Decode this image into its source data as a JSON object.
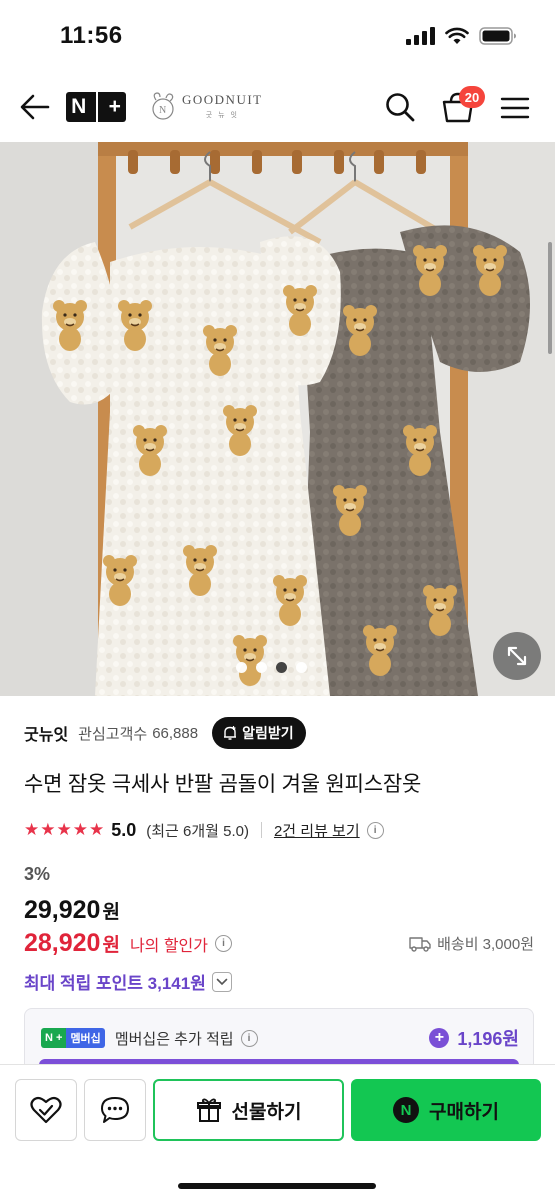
{
  "status_bar": {
    "time": "11:56"
  },
  "header": {
    "back_icon": "arrow-left-icon",
    "nplus_logo": {
      "left": "N",
      "right": "+"
    },
    "brand": {
      "name": "GOODNUIT",
      "sub": "굿 뉴 잇"
    },
    "search_icon": "search-icon",
    "cart_icon": "cart-icon",
    "cart_count": "20",
    "menu_icon": "hamburger-menu-icon"
  },
  "gallery": {
    "total_images": 4,
    "active_index": 2,
    "expand_icon": "expand-arrows-icon"
  },
  "store": {
    "name": "굿뉴잇",
    "follower_label": "관심고객수",
    "follower_count": "66,888",
    "notify_label": "알림받기",
    "notify_icon": "bell-plus-icon"
  },
  "product": {
    "title": "수면 잠옷 극세사 반팔 곰돌이 겨울 원피스잠옷",
    "stars": "★★★★★",
    "rating": "5.0",
    "rating_detail": "(최근 6개월 5.0)",
    "review_link": "2건 리뷰 보기",
    "discount_rate": "3%",
    "original_price": "29,920",
    "currency": "원",
    "sale_price": "28,920",
    "my_discount_label": "나의 할인가",
    "shipping_label": "배송비 3,000원",
    "points_label": "최대 적립 포인트 3,141원"
  },
  "membership": {
    "badge_left": "N +",
    "badge_right": "멤버십",
    "text": "멤버십은 추가 적립",
    "points": "1,196원"
  },
  "bottom_bar": {
    "wishlist_icon": "heart-check-icon",
    "talk_icon": "chat-bubble-icon",
    "gift_label": "선물하기",
    "gift_icon": "gift-box-icon",
    "buy_label": "구매하기",
    "buy_icon_letter": "N"
  },
  "colors": {
    "sale_red": "#e0243a",
    "points_purple": "#6a45c9",
    "naver_green": "#13c752",
    "star_red": "#e8334a",
    "badge_red": "#f5453c"
  }
}
